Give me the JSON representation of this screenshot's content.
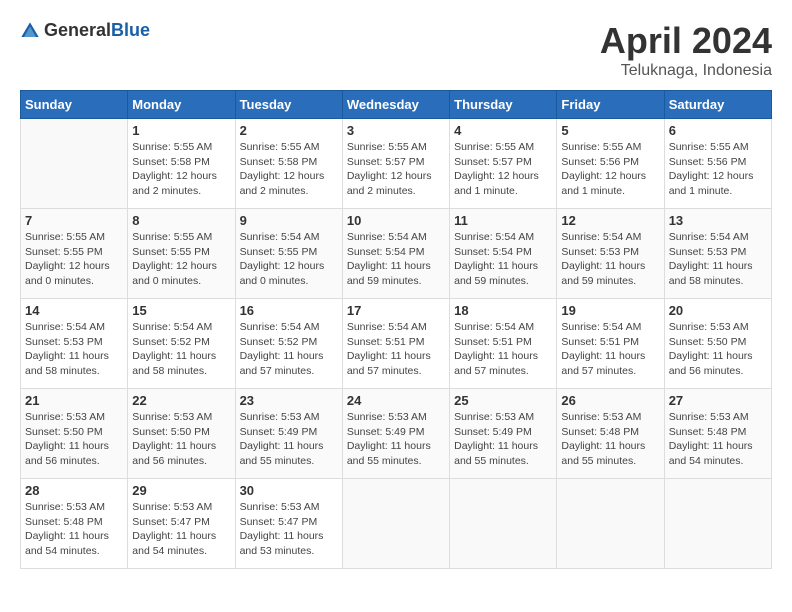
{
  "header": {
    "logo": {
      "text_general": "General",
      "text_blue": "Blue"
    },
    "title": "April 2024",
    "location": "Teluknaga, Indonesia"
  },
  "weekdays": [
    "Sunday",
    "Monday",
    "Tuesday",
    "Wednesday",
    "Thursday",
    "Friday",
    "Saturday"
  ],
  "weeks": [
    [
      {
        "day": "",
        "sunrise": "",
        "sunset": "",
        "daylight": ""
      },
      {
        "day": "1",
        "sunrise": "Sunrise: 5:55 AM",
        "sunset": "Sunset: 5:58 PM",
        "daylight": "Daylight: 12 hours and 2 minutes."
      },
      {
        "day": "2",
        "sunrise": "Sunrise: 5:55 AM",
        "sunset": "Sunset: 5:58 PM",
        "daylight": "Daylight: 12 hours and 2 minutes."
      },
      {
        "day": "3",
        "sunrise": "Sunrise: 5:55 AM",
        "sunset": "Sunset: 5:57 PM",
        "daylight": "Daylight: 12 hours and 2 minutes."
      },
      {
        "day": "4",
        "sunrise": "Sunrise: 5:55 AM",
        "sunset": "Sunset: 5:57 PM",
        "daylight": "Daylight: 12 hours and 1 minute."
      },
      {
        "day": "5",
        "sunrise": "Sunrise: 5:55 AM",
        "sunset": "Sunset: 5:56 PM",
        "daylight": "Daylight: 12 hours and 1 minute."
      },
      {
        "day": "6",
        "sunrise": "Sunrise: 5:55 AM",
        "sunset": "Sunset: 5:56 PM",
        "daylight": "Daylight: 12 hours and 1 minute."
      }
    ],
    [
      {
        "day": "7",
        "sunrise": "Sunrise: 5:55 AM",
        "sunset": "Sunset: 5:55 PM",
        "daylight": "Daylight: 12 hours and 0 minutes."
      },
      {
        "day": "8",
        "sunrise": "Sunrise: 5:55 AM",
        "sunset": "Sunset: 5:55 PM",
        "daylight": "Daylight: 12 hours and 0 minutes."
      },
      {
        "day": "9",
        "sunrise": "Sunrise: 5:54 AM",
        "sunset": "Sunset: 5:55 PM",
        "daylight": "Daylight: 12 hours and 0 minutes."
      },
      {
        "day": "10",
        "sunrise": "Sunrise: 5:54 AM",
        "sunset": "Sunset: 5:54 PM",
        "daylight": "Daylight: 11 hours and 59 minutes."
      },
      {
        "day": "11",
        "sunrise": "Sunrise: 5:54 AM",
        "sunset": "Sunset: 5:54 PM",
        "daylight": "Daylight: 11 hours and 59 minutes."
      },
      {
        "day": "12",
        "sunrise": "Sunrise: 5:54 AM",
        "sunset": "Sunset: 5:53 PM",
        "daylight": "Daylight: 11 hours and 59 minutes."
      },
      {
        "day": "13",
        "sunrise": "Sunrise: 5:54 AM",
        "sunset": "Sunset: 5:53 PM",
        "daylight": "Daylight: 11 hours and 58 minutes."
      }
    ],
    [
      {
        "day": "14",
        "sunrise": "Sunrise: 5:54 AM",
        "sunset": "Sunset: 5:53 PM",
        "daylight": "Daylight: 11 hours and 58 minutes."
      },
      {
        "day": "15",
        "sunrise": "Sunrise: 5:54 AM",
        "sunset": "Sunset: 5:52 PM",
        "daylight": "Daylight: 11 hours and 58 minutes."
      },
      {
        "day": "16",
        "sunrise": "Sunrise: 5:54 AM",
        "sunset": "Sunset: 5:52 PM",
        "daylight": "Daylight: 11 hours and 57 minutes."
      },
      {
        "day": "17",
        "sunrise": "Sunrise: 5:54 AM",
        "sunset": "Sunset: 5:51 PM",
        "daylight": "Daylight: 11 hours and 57 minutes."
      },
      {
        "day": "18",
        "sunrise": "Sunrise: 5:54 AM",
        "sunset": "Sunset: 5:51 PM",
        "daylight": "Daylight: 11 hours and 57 minutes."
      },
      {
        "day": "19",
        "sunrise": "Sunrise: 5:54 AM",
        "sunset": "Sunset: 5:51 PM",
        "daylight": "Daylight: 11 hours and 57 minutes."
      },
      {
        "day": "20",
        "sunrise": "Sunrise: 5:53 AM",
        "sunset": "Sunset: 5:50 PM",
        "daylight": "Daylight: 11 hours and 56 minutes."
      }
    ],
    [
      {
        "day": "21",
        "sunrise": "Sunrise: 5:53 AM",
        "sunset": "Sunset: 5:50 PM",
        "daylight": "Daylight: 11 hours and 56 minutes."
      },
      {
        "day": "22",
        "sunrise": "Sunrise: 5:53 AM",
        "sunset": "Sunset: 5:50 PM",
        "daylight": "Daylight: 11 hours and 56 minutes."
      },
      {
        "day": "23",
        "sunrise": "Sunrise: 5:53 AM",
        "sunset": "Sunset: 5:49 PM",
        "daylight": "Daylight: 11 hours and 55 minutes."
      },
      {
        "day": "24",
        "sunrise": "Sunrise: 5:53 AM",
        "sunset": "Sunset: 5:49 PM",
        "daylight": "Daylight: 11 hours and 55 minutes."
      },
      {
        "day": "25",
        "sunrise": "Sunrise: 5:53 AM",
        "sunset": "Sunset: 5:49 PM",
        "daylight": "Daylight: 11 hours and 55 minutes."
      },
      {
        "day": "26",
        "sunrise": "Sunrise: 5:53 AM",
        "sunset": "Sunset: 5:48 PM",
        "daylight": "Daylight: 11 hours and 55 minutes."
      },
      {
        "day": "27",
        "sunrise": "Sunrise: 5:53 AM",
        "sunset": "Sunset: 5:48 PM",
        "daylight": "Daylight: 11 hours and 54 minutes."
      }
    ],
    [
      {
        "day": "28",
        "sunrise": "Sunrise: 5:53 AM",
        "sunset": "Sunset: 5:48 PM",
        "daylight": "Daylight: 11 hours and 54 minutes."
      },
      {
        "day": "29",
        "sunrise": "Sunrise: 5:53 AM",
        "sunset": "Sunset: 5:47 PM",
        "daylight": "Daylight: 11 hours and 54 minutes."
      },
      {
        "day": "30",
        "sunrise": "Sunrise: 5:53 AM",
        "sunset": "Sunset: 5:47 PM",
        "daylight": "Daylight: 11 hours and 53 minutes."
      },
      {
        "day": "",
        "sunrise": "",
        "sunset": "",
        "daylight": ""
      },
      {
        "day": "",
        "sunrise": "",
        "sunset": "",
        "daylight": ""
      },
      {
        "day": "",
        "sunrise": "",
        "sunset": "",
        "daylight": ""
      },
      {
        "day": "",
        "sunrise": "",
        "sunset": "",
        "daylight": ""
      }
    ]
  ]
}
